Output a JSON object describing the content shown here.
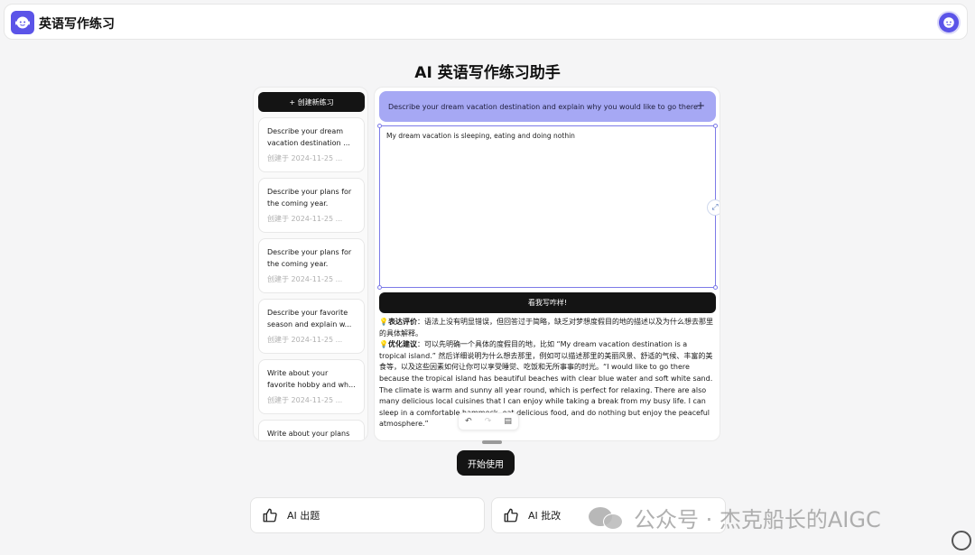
{
  "header": {
    "app_title": "英语写作练习",
    "logo_icon": "assistant-face-icon",
    "avatar_icon": "user-avatar-icon",
    "brand_color": "#5b54e8"
  },
  "page": {
    "title": "AI 英语写作练习助手"
  },
  "sidebar": {
    "new_button": "+ 创建新练习",
    "items": [
      {
        "title": "Describe your dream vacation destination ...",
        "date": "创建于 2024-11-25 ..."
      },
      {
        "title": "Describe your plans for the coming year.",
        "date": "创建于 2024-11-25 ..."
      },
      {
        "title": "Describe your plans for the coming year.",
        "date": "创建于 2024-11-25 ..."
      },
      {
        "title": "Describe your favorite season and explain w...",
        "date": "创建于 2024-11-25 ..."
      },
      {
        "title": "Write about your favorite hobby and wh...",
        "date": "创建于 2024-11-25 ..."
      },
      {
        "title": "Write about your plans for the coming...",
        "date": ""
      }
    ]
  },
  "main": {
    "prompt": "Describe your dream vacation destination and explain why you would like to go there.",
    "prompt_add": "+",
    "editor_text": "My dream vacation is sleeping, eating and doing nothin",
    "submit_button": "看我写咋样!",
    "feedback": {
      "eval_label": "表达评价",
      "eval_text": "：语法上没有明显错误，但回答过于简略，缺乏对梦想度假目的地的描述以及为什么想去那里的具体解释。",
      "opt_label": "优化建议",
      "opt_text": "：可以先明确一个具体的度假目的地，比如 “My dream vacation destination is a tropical island.” 然后详细说明为什么想去那里，例如可以描述那里的美丽风景、舒适的气候、丰富的美食等，以及这些因素如何让你可以享受睡觉、吃饭和无所事事的时光。“I would like to go there because the tropical island has beautiful beaches with clear blue water and soft white sand. The climate is warm and sunny all year round, which is perfect for relaxing. There are also many delicious local cuisines that I can enjoy while taking a break from my busy life. I can sleep in a comfortable hammock, eat delicious food, and do nothing but enjoy the peaceful atmosphere.”"
    }
  },
  "start_button": "开始使用",
  "features": [
    {
      "label": "AI 出题",
      "icon": "thumbs-up-icon"
    },
    {
      "label": "AI 批改",
      "icon": "thumbs-up-icon"
    }
  ],
  "watermark": {
    "text": "公众号 · 杰克船长的AIGC",
    "icon": "wechat-icon"
  }
}
